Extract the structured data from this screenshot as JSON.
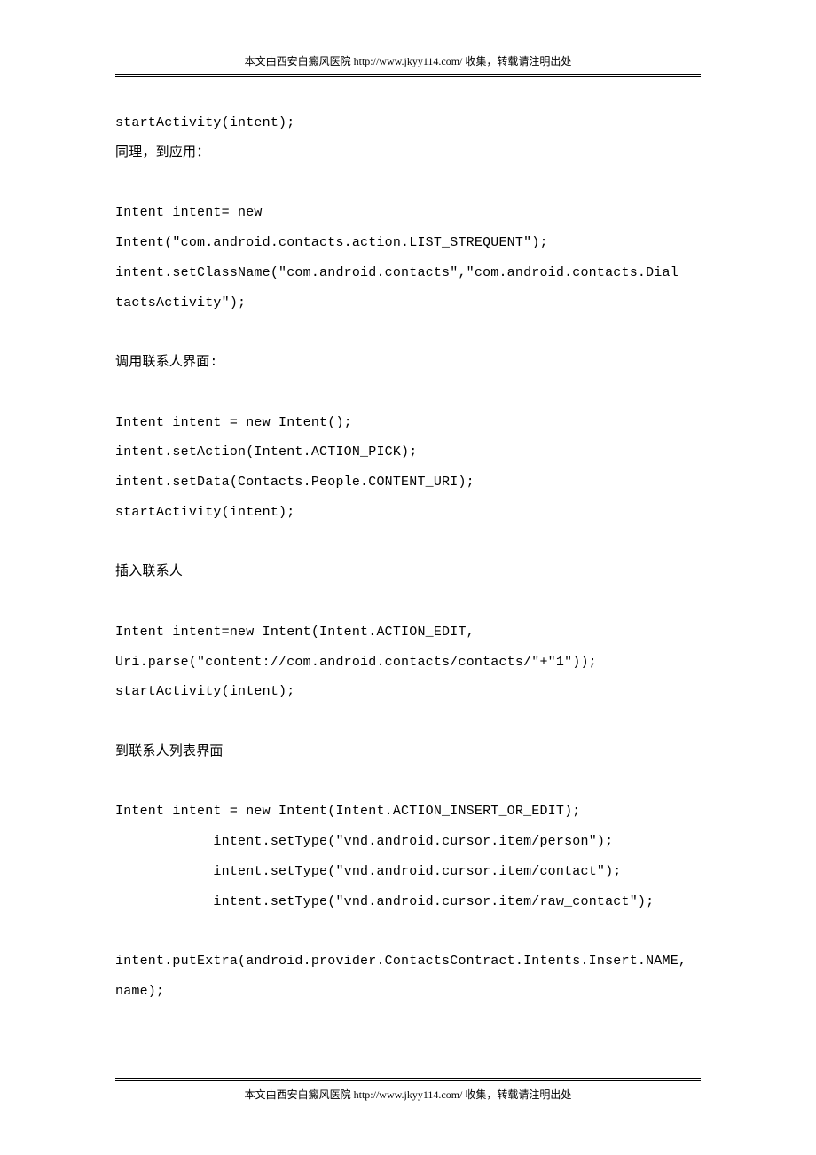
{
  "header": {
    "prefix": "本文由西安白癜风医院 ",
    "link": "http://www.jkyy114.com/",
    "suffix": "  收集，转载请注明出处"
  },
  "footer": {
    "prefix": "本文由西安白癜风医院 ",
    "link": "http://www.jkyy114.com/",
    "suffix": "  收集，转载请注明出处"
  },
  "content": {
    "lines": [
      "startActivity(intent);",
      "同理，到应用：",
      "",
      "Intent intent= new",
      "Intent(\"com.android.contacts.action.LIST_STREQUENT\");",
      "intent.setClassName(\"com.android.contacts\",\"com.android.contacts.Dial",
      "tactsActivity\");",
      "",
      "调用联系人界面:",
      "",
      "Intent intent = new Intent();",
      "intent.setAction(Intent.ACTION_PICK);",
      "intent.setData(Contacts.People.CONTENT_URI);",
      "startActivity(intent);",
      "",
      "插入联系人",
      "",
      "Intent intent=new Intent(Intent.ACTION_EDIT,",
      "Uri.parse(\"content://com.android.contacts/contacts/\"+\"1\"));",
      "startActivity(intent);",
      "",
      "到联系人列表界面",
      "",
      "Intent intent = new Intent(Intent.ACTION_INSERT_OR_EDIT);",
      "            intent.setType(\"vnd.android.cursor.item/person\");",
      "            intent.setType(\"vnd.android.cursor.item/contact\");",
      "            intent.setType(\"vnd.android.cursor.item/raw_contact\");",
      "",
      "intent.putExtra(android.provider.ContactsContract.Intents.Insert.NAME,",
      "name);"
    ]
  }
}
